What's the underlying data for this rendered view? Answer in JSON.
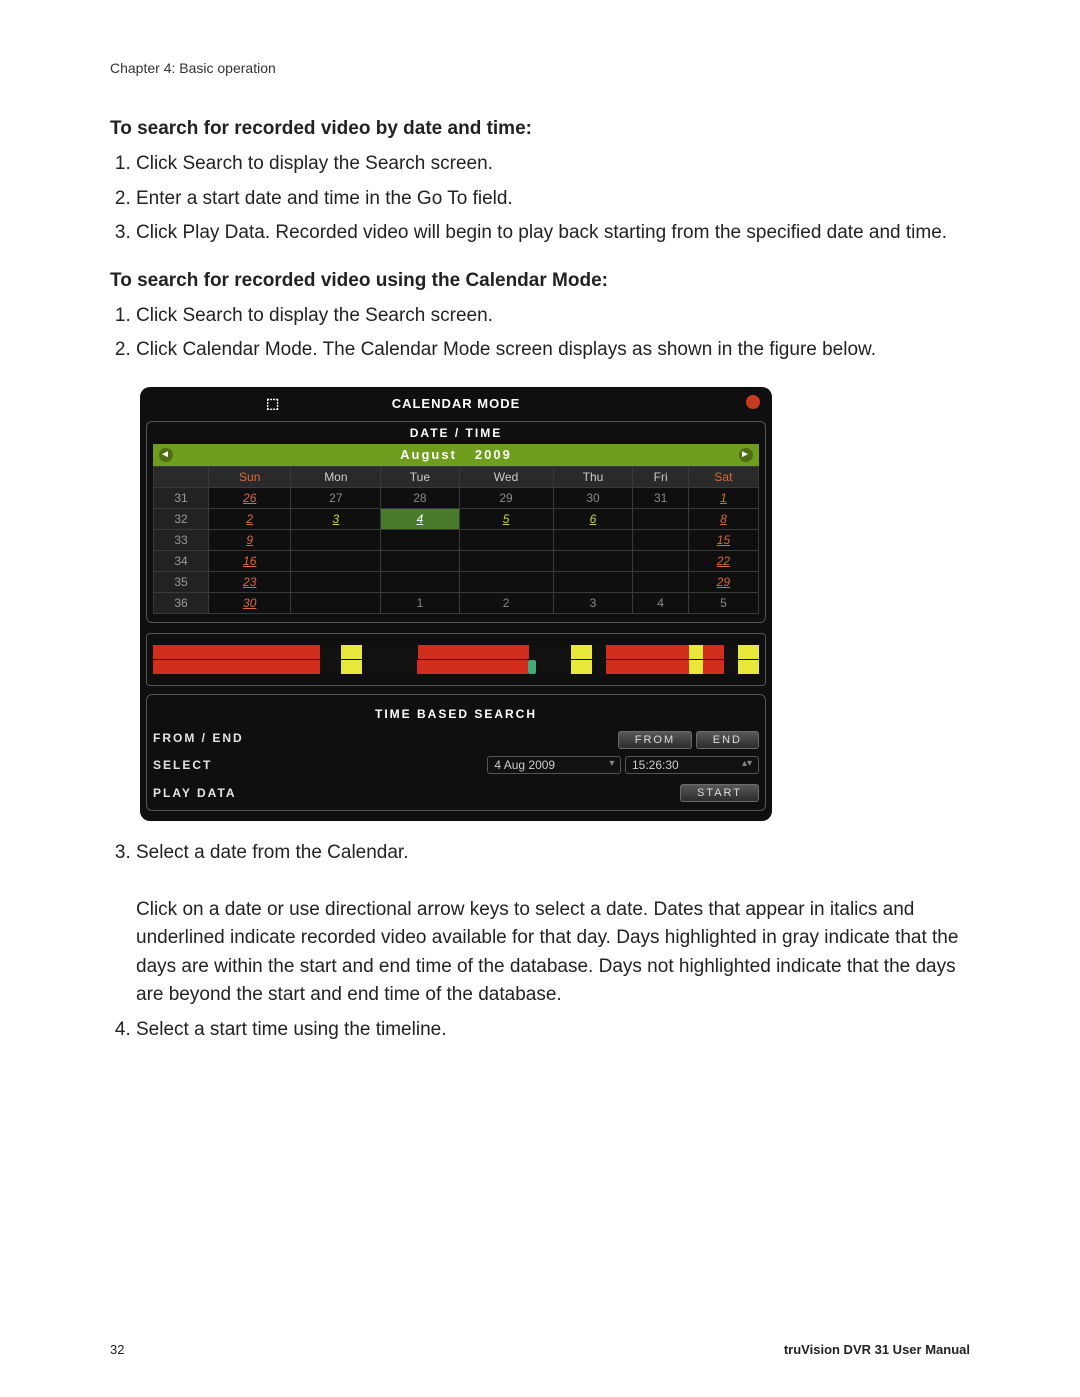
{
  "header": {
    "chapter": "Chapter 4: Basic operation"
  },
  "section1": {
    "heading": "To search for recorded video by date and time:",
    "steps": [
      "Click Search to display the Search screen.",
      "Enter a start date and time in the Go To field.",
      "Click Play Data. Recorded video will begin to play back starting from the specified date and time."
    ]
  },
  "section2": {
    "heading": "To search for recorded video using the Calendar Mode:",
    "steps_before": [
      "Click Search to display the Search screen.",
      "Click Calendar Mode. The Calendar Mode screen displays as shown in the figure below."
    ],
    "step3_lead": "Select a date from the Calendar.",
    "step3_body": "Click on a date or use directional arrow keys to select a date. Dates that appear in italics and underlined indicate recorded video available for that day. Days highlighted in gray indicate that the days are within the start and end time of the database. Days not highlighted indicate that the days are beyond the start and end time of the database.",
    "step4": "Select a start time using the timeline."
  },
  "figure": {
    "title": "CALENDAR MODE",
    "panel_title": "DATE / TIME",
    "month": "August",
    "year": "2009",
    "days": {
      "wk": "",
      "sun": "Sun",
      "mon": "Mon",
      "tue": "Tue",
      "wed": "Wed",
      "thu": "Thu",
      "fri": "Fri",
      "sat": "Sat"
    },
    "weeks": [
      "31",
      "32",
      "33",
      "34",
      "35",
      "36"
    ],
    "cells": [
      [
        "26",
        "27",
        "28",
        "29",
        "30",
        "31",
        "1"
      ],
      [
        "2",
        "3",
        "4",
        "5",
        "6",
        "",
        "8"
      ],
      [
        "9",
        "",
        "",
        "",
        "",
        "",
        "15"
      ],
      [
        "16",
        "",
        "",
        "",
        "",
        "",
        "22"
      ],
      [
        "23",
        "",
        "",
        "",
        "",
        "",
        "29"
      ],
      [
        "30",
        "",
        "1",
        "2",
        "3",
        "4",
        "5"
      ]
    ],
    "tbs_title": "TIME BASED SEARCH",
    "from_end_label": "FROM / END",
    "from_btn": "FROM",
    "end_btn": "END",
    "select_label": "SELECT",
    "select_date": "4 Aug 2009",
    "select_time": "15:26:30",
    "play_data_label": "PLAY DATA",
    "start_btn": "START"
  },
  "footer": {
    "page": "32",
    "manual": "truVision DVR 31 User Manual"
  }
}
